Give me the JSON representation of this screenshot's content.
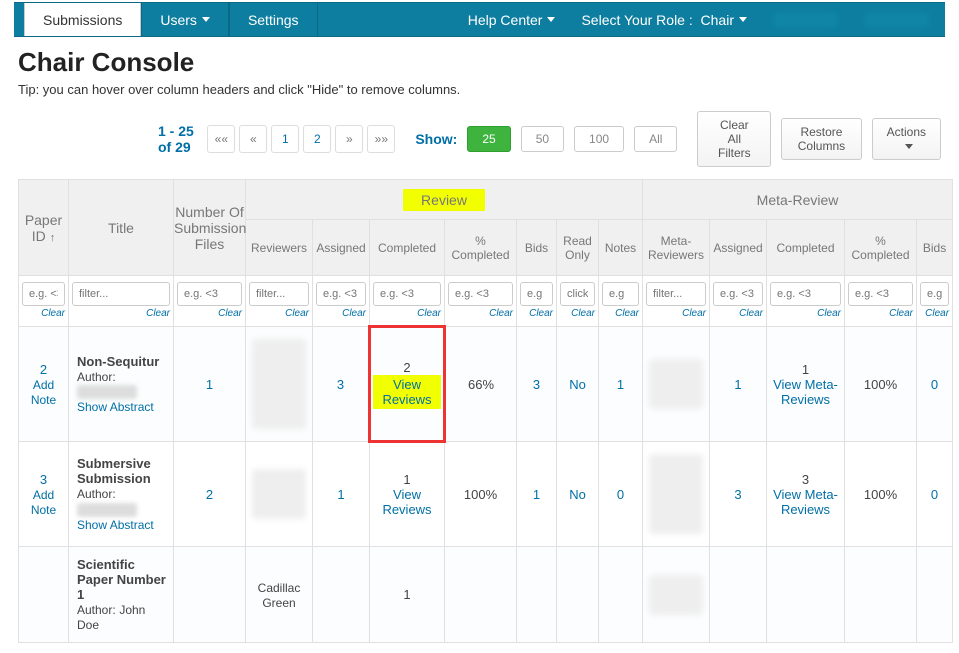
{
  "nav": {
    "submissions": "Submissions",
    "users": "Users",
    "settings": "Settings",
    "help": "Help Center",
    "role_label": "Select Your Role :",
    "role_value": "Chair"
  },
  "header": {
    "title": "Chair Console",
    "tip": "Tip: you can hover over column headers and click \"Hide\" to remove columns."
  },
  "toolbar": {
    "range": "1 - 25 of 29",
    "first": "««",
    "prev": "«",
    "p1": "1",
    "p2": "2",
    "next": "»",
    "last": "»»",
    "show_label": "Show:",
    "s25": "25",
    "s50": "50",
    "s100": "100",
    "sall": "All",
    "clear_filters": "Clear All Filters",
    "restore": "Restore Columns",
    "actions": "Actions"
  },
  "columns": {
    "paper_id": "Paper ID",
    "title": "Title",
    "files": "Number Of Submission Files",
    "review_group": "Review",
    "meta_group": "Meta-Review",
    "reviewers": "Reviewers",
    "assigned": "Assigned",
    "completed": "Completed",
    "pct": "% Completed",
    "bids": "Bids",
    "read_only": "Read Only",
    "notes": "Notes",
    "meta_reviewers": "Meta-Reviewers"
  },
  "filters": {
    "eg_lt": "e.g. <3",
    "filter": "filter...",
    "eg": "e.g",
    "click": "click",
    "clear": "Clear"
  },
  "rows": [
    {
      "id": "2",
      "add_note": "Add Note",
      "title": "Non-Sequitur",
      "author_label": "Author:",
      "show_abstract": "Show Abstract",
      "files": "1",
      "assigned": "3",
      "completed_n": "2",
      "view_reviews": "View Reviews",
      "pct": "66%",
      "bids": "3",
      "read_only": "No",
      "notes": "1",
      "m_assigned": "1",
      "m_completed_n": "1",
      "view_meta": "View Meta-Reviews",
      "m_pct": "100%",
      "m_bids": "0"
    },
    {
      "id": "3",
      "add_note": "Add Note",
      "title": "Submersive Submission",
      "author_label": "Author:",
      "show_abstract": "Show Abstract",
      "files": "2",
      "assigned": "1",
      "completed_n": "1",
      "view_reviews": "View Reviews",
      "pct": "100%",
      "bids": "1",
      "read_only": "No",
      "notes": "0",
      "m_assigned": "3",
      "m_completed_n": "3",
      "view_meta": "View Meta-Reviews",
      "m_pct": "100%",
      "m_bids": "0"
    },
    {
      "id": "",
      "add_note": "",
      "title": "Scientific Paper Number 1",
      "author_label": "Author:",
      "author_name": "John Doe",
      "show_abstract": "",
      "files_text": "Cadillac Green",
      "assigned": "",
      "completed_n": "1",
      "view_reviews": "",
      "pct": "",
      "bids": "",
      "read_only": "",
      "notes": "",
      "m_assigned": "",
      "m_completed_n": "",
      "view_meta": "",
      "m_pct": "",
      "m_bids": ""
    }
  ]
}
